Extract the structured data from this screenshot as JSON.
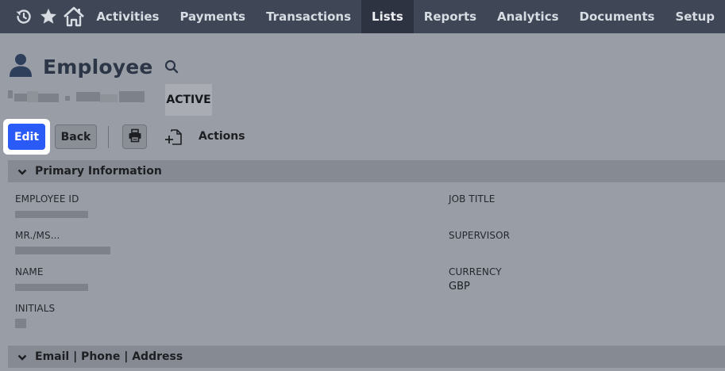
{
  "nav": {
    "icons": [
      "recent-icon",
      "star-icon",
      "home-icon"
    ],
    "items": [
      "Activities",
      "Payments",
      "Transactions",
      "Lists",
      "Reports",
      "Analytics",
      "Documents",
      "Setup"
    ],
    "active": "Lists"
  },
  "header": {
    "title": "Employee",
    "status": "ACTIVE"
  },
  "toolbar": {
    "edit_label": "Edit",
    "back_label": "Back",
    "actions_label": "Actions"
  },
  "sections": {
    "primary": "Primary Information",
    "contact": "Email | Phone | Address"
  },
  "fields": {
    "employee_id": {
      "label": "EMPLOYEE ID"
    },
    "salutation": {
      "label": "MR./MS..."
    },
    "name": {
      "label": "NAME"
    },
    "initials": {
      "label": "INITIALS"
    },
    "job_title": {
      "label": "JOB TITLE"
    },
    "supervisor": {
      "label": "SUPERVISOR"
    },
    "currency": {
      "label": "CURRENCY",
      "value": "GBP"
    }
  },
  "colors": {
    "nav_bg": "#3f4756",
    "edit_button": "#2a5bf6",
    "overlay_bg": "#999ea6"
  }
}
